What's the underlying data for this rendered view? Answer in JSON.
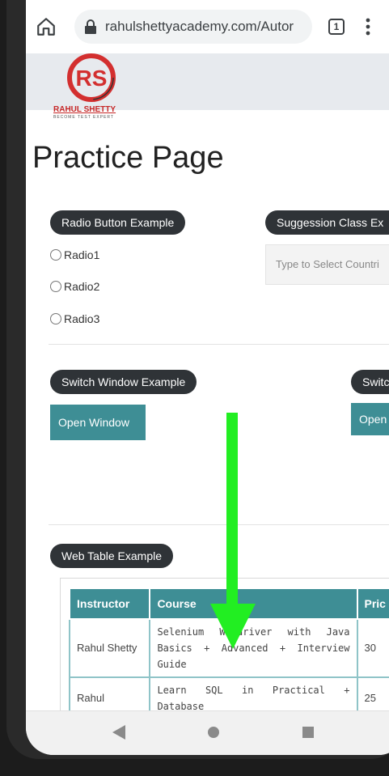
{
  "browser": {
    "url": "rahulshettyacademy.com/Autor",
    "tab_count": "1",
    "icons": {
      "home": "home-icon",
      "lock": "lock-icon",
      "menu": "more-vert-icon"
    }
  },
  "logo": {
    "text": "RAHUL SHETTY",
    "tagline": "BECOME TEST EXPERT"
  },
  "page": {
    "title": "Practice Page"
  },
  "radio_section": {
    "legend": "Radio Button Example",
    "options": [
      "Radio1",
      "Radio2",
      "Radio3"
    ]
  },
  "suggestion_section": {
    "legend": "Suggession Class Ex",
    "placeholder": "Type to Select Countri"
  },
  "switch_window": {
    "legend": "Switch Window Example",
    "button": "Open Window"
  },
  "switch_tab": {
    "legend": "Switch",
    "button": "Open T"
  },
  "web_table": {
    "legend": "Web Table Example",
    "headers": [
      "Instructor",
      "Course",
      "Pric"
    ],
    "rows": [
      {
        "instructor": "Rahul Shetty",
        "course": "Selenium Webdriver with Java Basics + Advanced + Interview Guide",
        "price": "30"
      },
      {
        "instructor": "Rahul",
        "course": "Learn SQL in Practical + Database",
        "price": "25"
      }
    ]
  },
  "colors": {
    "teal": "#3e8e95",
    "legend_bg": "#2f3337",
    "arrow": "#22ee22"
  }
}
